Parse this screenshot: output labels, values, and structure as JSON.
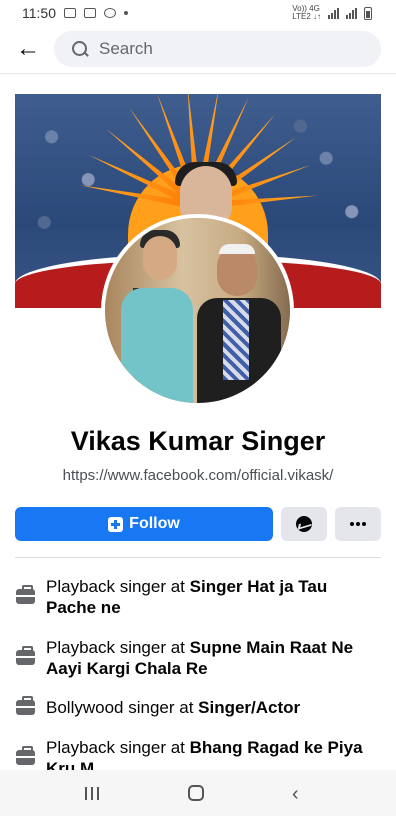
{
  "status_bar": {
    "time": "11:50",
    "network_top": "Vo)) 4G",
    "network_bottom": "LTE2 ↓↑"
  },
  "header": {
    "back_glyph": "←",
    "search_placeholder": "Search"
  },
  "profile": {
    "name": "Vikas Kumar Singer",
    "url": "https://www.facebook.com/official.vikask/"
  },
  "actions": {
    "follow_label": "Follow"
  },
  "work": [
    {
      "prefix": "Playback singer at ",
      "place": "Singer Hat ja Tau Pache ne"
    },
    {
      "prefix": "Playback singer at ",
      "place": "Supne Main Raat Ne Aayi Kargi Chala Re"
    },
    {
      "prefix": "Bollywood singer at ",
      "place": "Singer/Actor"
    },
    {
      "prefix": "Playback singer at ",
      "place": "Bhang Ragad ke Piya Kru M"
    }
  ],
  "nav": {
    "back_glyph": "‹"
  },
  "colors": {
    "accent": "#1877f2",
    "secondary_button": "#e4e6eb",
    "text_primary": "#050505",
    "text_secondary": "#65676b"
  },
  "icons": [
    "arrow-left-icon",
    "search-icon",
    "follow-add-icon",
    "messenger-icon",
    "more-dots-icon",
    "briefcase-icon"
  ]
}
